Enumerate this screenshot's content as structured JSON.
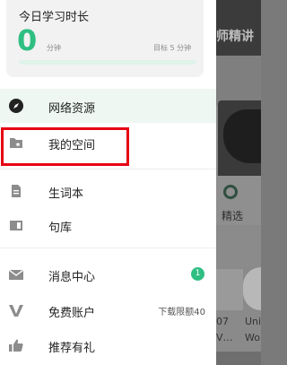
{
  "background": {
    "header_text": "师精讲",
    "badge_label": "精选",
    "thumb_texts": [
      "07",
      "Uni",
      "V…",
      "Wor"
    ]
  },
  "study": {
    "title": "今日学习时长",
    "minutes": "0",
    "unit": "分钟",
    "goal": "目标 5 分钟",
    "progress": 0
  },
  "menu": {
    "items": [
      {
        "label": "网络资源",
        "icon": "compass-icon"
      },
      {
        "label": "我的空间",
        "icon": "folder-star-icon"
      },
      {
        "label": "生词本",
        "icon": "document-icon"
      },
      {
        "label": "句库",
        "icon": "book-icon"
      },
      {
        "label": "消息中心",
        "icon": "mail-icon",
        "badge": "1"
      },
      {
        "label": "免费账户",
        "icon": "v-logo-icon",
        "extra": "下载限额40"
      },
      {
        "label": "推荐有礼",
        "icon": "thumbs-up-icon"
      }
    ]
  },
  "colors": {
    "accent": "#2fbf83",
    "highlight": "#e60012",
    "icon": "#8c8c8c"
  }
}
